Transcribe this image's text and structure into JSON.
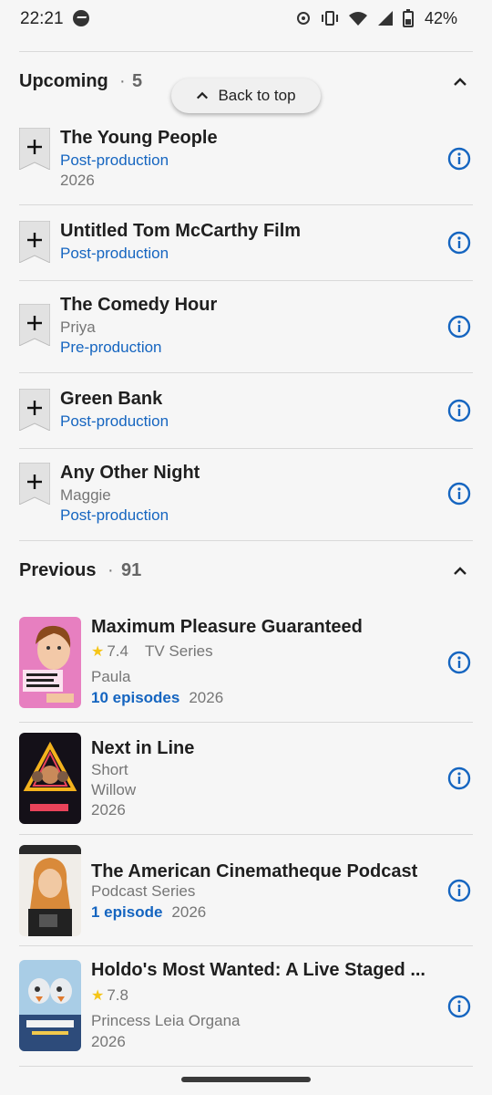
{
  "status": {
    "time": "22:21",
    "battery": "42%"
  },
  "back_to_top": "Back to top",
  "upcoming": {
    "title": "Upcoming",
    "dot": "·",
    "count": "5",
    "items": [
      {
        "title": "The Young People",
        "lines": [
          "Post-production",
          "2026"
        ]
      },
      {
        "title": "Untitled Tom McCarthy Film",
        "lines": [
          "Post-production"
        ]
      },
      {
        "title": "The Comedy Hour",
        "lines": [
          "Priya",
          "Pre-production"
        ]
      },
      {
        "title": "Green Bank",
        "lines": [
          "Post-production"
        ]
      },
      {
        "title": "Any Other Night",
        "lines": [
          "Maggie",
          "Post-production"
        ]
      }
    ]
  },
  "previous": {
    "title": "Previous",
    "dot": "·",
    "count": "91",
    "items": [
      {
        "title": "Maximum Pleasure Guaranteed",
        "rating": "7.4",
        "type": "TV Series",
        "role": "Paula",
        "episodes": "10 episodes",
        "year": "2026"
      },
      {
        "title": "Next in Line",
        "type": "Short",
        "role": "Willow",
        "year": "2026"
      },
      {
        "title": "The American Cinematheque Podcast",
        "type": "Podcast Series",
        "episodes": "1 episode",
        "year": "2026"
      },
      {
        "title": "Holdo's Most Wanted: A Live Staged ...",
        "rating": "7.8",
        "role": "Princess Leia Organa",
        "year": "2026"
      }
    ]
  },
  "colors": {
    "link_blue": "#1565c0",
    "star": "#f5c518"
  },
  "icons": [
    "add-to-watchlist-icon",
    "info-icon",
    "chevron-up-icon",
    "star-icon"
  ]
}
